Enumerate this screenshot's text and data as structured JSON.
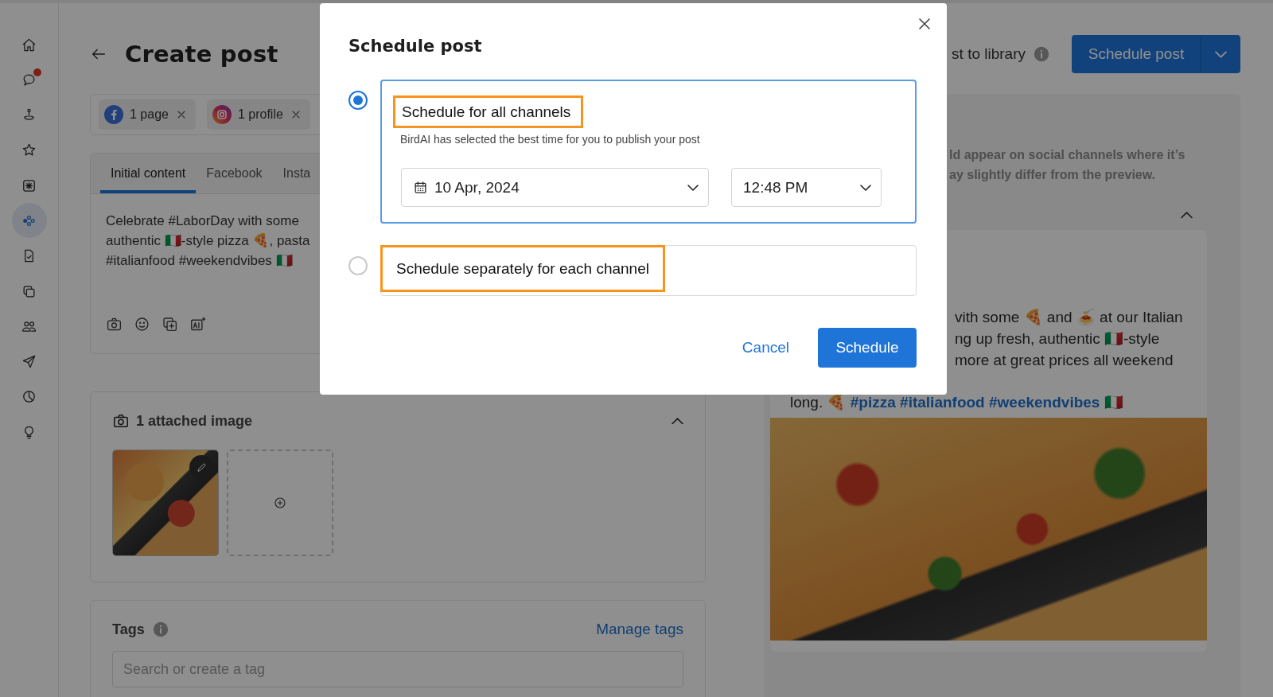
{
  "sidebar": {
    "items": [
      {
        "selected": false,
        "badge": false
      },
      {
        "selected": false,
        "badge": true
      },
      {
        "selected": false,
        "badge": false
      },
      {
        "selected": false,
        "badge": false
      },
      {
        "selected": false,
        "badge": false
      },
      {
        "selected": true,
        "badge": false
      },
      {
        "selected": false,
        "badge": false
      },
      {
        "selected": false,
        "badge": false
      },
      {
        "selected": false,
        "badge": false
      },
      {
        "selected": false,
        "badge": false
      },
      {
        "selected": false,
        "badge": false
      },
      {
        "selected": false,
        "badge": false
      }
    ]
  },
  "header": {
    "title": "Create post",
    "library_text": "st to library",
    "primary_button": "Schedule post"
  },
  "channels": [
    {
      "kind": "facebook",
      "label": "1 page"
    },
    {
      "kind": "instagram",
      "label": "1 profile"
    }
  ],
  "editor": {
    "tabs": [
      {
        "label": "Initial content",
        "selected": true
      },
      {
        "label": "Facebook",
        "selected": false
      },
      {
        "label": "Insta",
        "selected": false
      }
    ],
    "lines": [
      "Celebrate #LaborDay with some",
      "authentic 🇮🇹-style pizza 🍕, pasta",
      "#italianfood #weekendvibes 🇮🇹"
    ]
  },
  "attachments": {
    "title": "1 attached image",
    "expanded": true
  },
  "tags": {
    "title": "Tags",
    "manage_link": "Manage tags",
    "placeholder": "Search or create a tag"
  },
  "preview": {
    "info_lines": [
      "ld appear on social channels where it’s",
      "ay slightly differ from the preview."
    ],
    "expanded": true,
    "post_lines": [
      "vith some 🍕 and 🍝 at our Italian",
      "ng up fresh, authentic 🇮🇹-style",
      "more at great prices all weekend"
    ],
    "last_line": [
      {
        "kind": "text",
        "text": "long. 🍕"
      },
      {
        "kind": "hashtag",
        "text": "#pizza"
      },
      {
        "kind": "hashtag",
        "text": "#italianfood"
      },
      {
        "kind": "hashtag",
        "text": "#weekendvibes"
      },
      {
        "kind": "text",
        "text": "🇮🇹"
      }
    ]
  },
  "modal": {
    "title": "Schedule post",
    "options": [
      {
        "label": "Schedule for all channels",
        "selected": true,
        "description": "BirdAI has selected the best time for you to publish your post",
        "date": "10 Apr, 2024",
        "time": "12:48 PM"
      },
      {
        "label": "Schedule separately for each channel",
        "selected": false
      }
    ],
    "cancel": "Cancel",
    "confirm": "Schedule"
  }
}
